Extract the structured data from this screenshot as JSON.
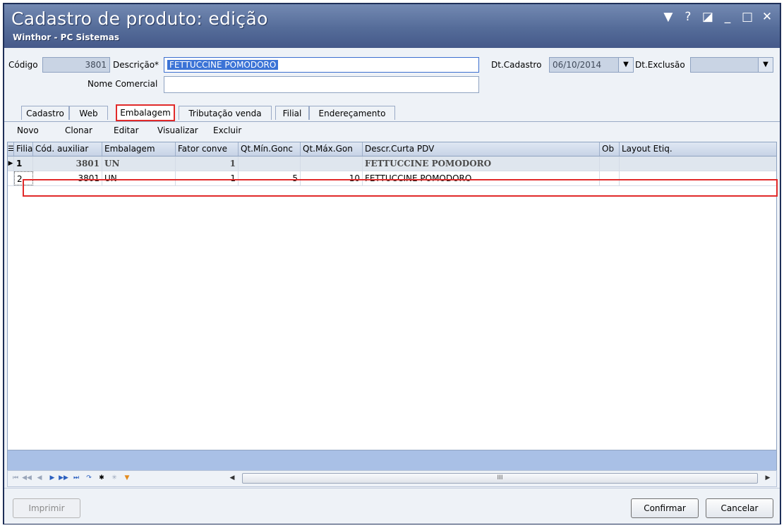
{
  "window": {
    "title": "Cadastro de produto: edição",
    "subtitle": "Winthor - PC Sistemas",
    "controls": [
      "▼",
      "?",
      "◪",
      "_",
      "□",
      "✕"
    ]
  },
  "form": {
    "codigo_label": "Código",
    "codigo_value": "3801",
    "descricao_label": "Descrição*",
    "descricao_value": "FETTUCCINE POMODORO",
    "nome_comercial_label": "Nome Comercial",
    "nome_comercial_value": "",
    "dt_cadastro_label": "Dt.Cadastro",
    "dt_cadastro_value": "06/10/2014",
    "dt_exclusao_label": "Dt.Exclusão",
    "dt_exclusao_value": ""
  },
  "tabs": [
    {
      "label": "Cadastro"
    },
    {
      "label": "Web"
    },
    {
      "label": "Embalagem"
    },
    {
      "label": "Tributação venda"
    },
    {
      "label": "Filial"
    },
    {
      "label": "Endereçamento"
    }
  ],
  "active_tab": "Embalagem",
  "toolbar": {
    "novo": "Novo",
    "clonar": "Clonar",
    "editar": "Editar",
    "visualizar": "Visualizar",
    "excluir": "Excluir"
  },
  "grid": {
    "columns": [
      "Filia",
      "Cód. auxiliar",
      "Embalagem",
      "Fator conve",
      "Qt.Mín.Gonc",
      "Qt.Máx.Gon",
      "Descr.Curta PDV",
      "Ob",
      "Layout Etiq."
    ],
    "rows": [
      {
        "filial": "1",
        "cod_aux": "3801",
        "embalagem": "UN",
        "fator": "1",
        "qt_min": "",
        "qt_max": "",
        "descr": "FETTUCCINE POMODORO",
        "ob": "",
        "layout": ""
      },
      {
        "filial": "2",
        "cod_aux": "3801",
        "embalagem": "UN",
        "fator": "1",
        "qt_min": "5",
        "qt_max": "10",
        "descr": "FETTUCCINE POMODORO",
        "ob": "",
        "layout": ""
      }
    ]
  },
  "scrollbar": {
    "thumb": "III"
  },
  "footer": {
    "imprimir": "Imprimir",
    "confirmar": "Confirmar",
    "cancelar": "Cancelar"
  },
  "colors": {
    "title_bar": "#556c99",
    "highlight_red": "#e12a2a",
    "selection_blue": "#3b73d6",
    "group_bar": "#a9c0e6"
  }
}
